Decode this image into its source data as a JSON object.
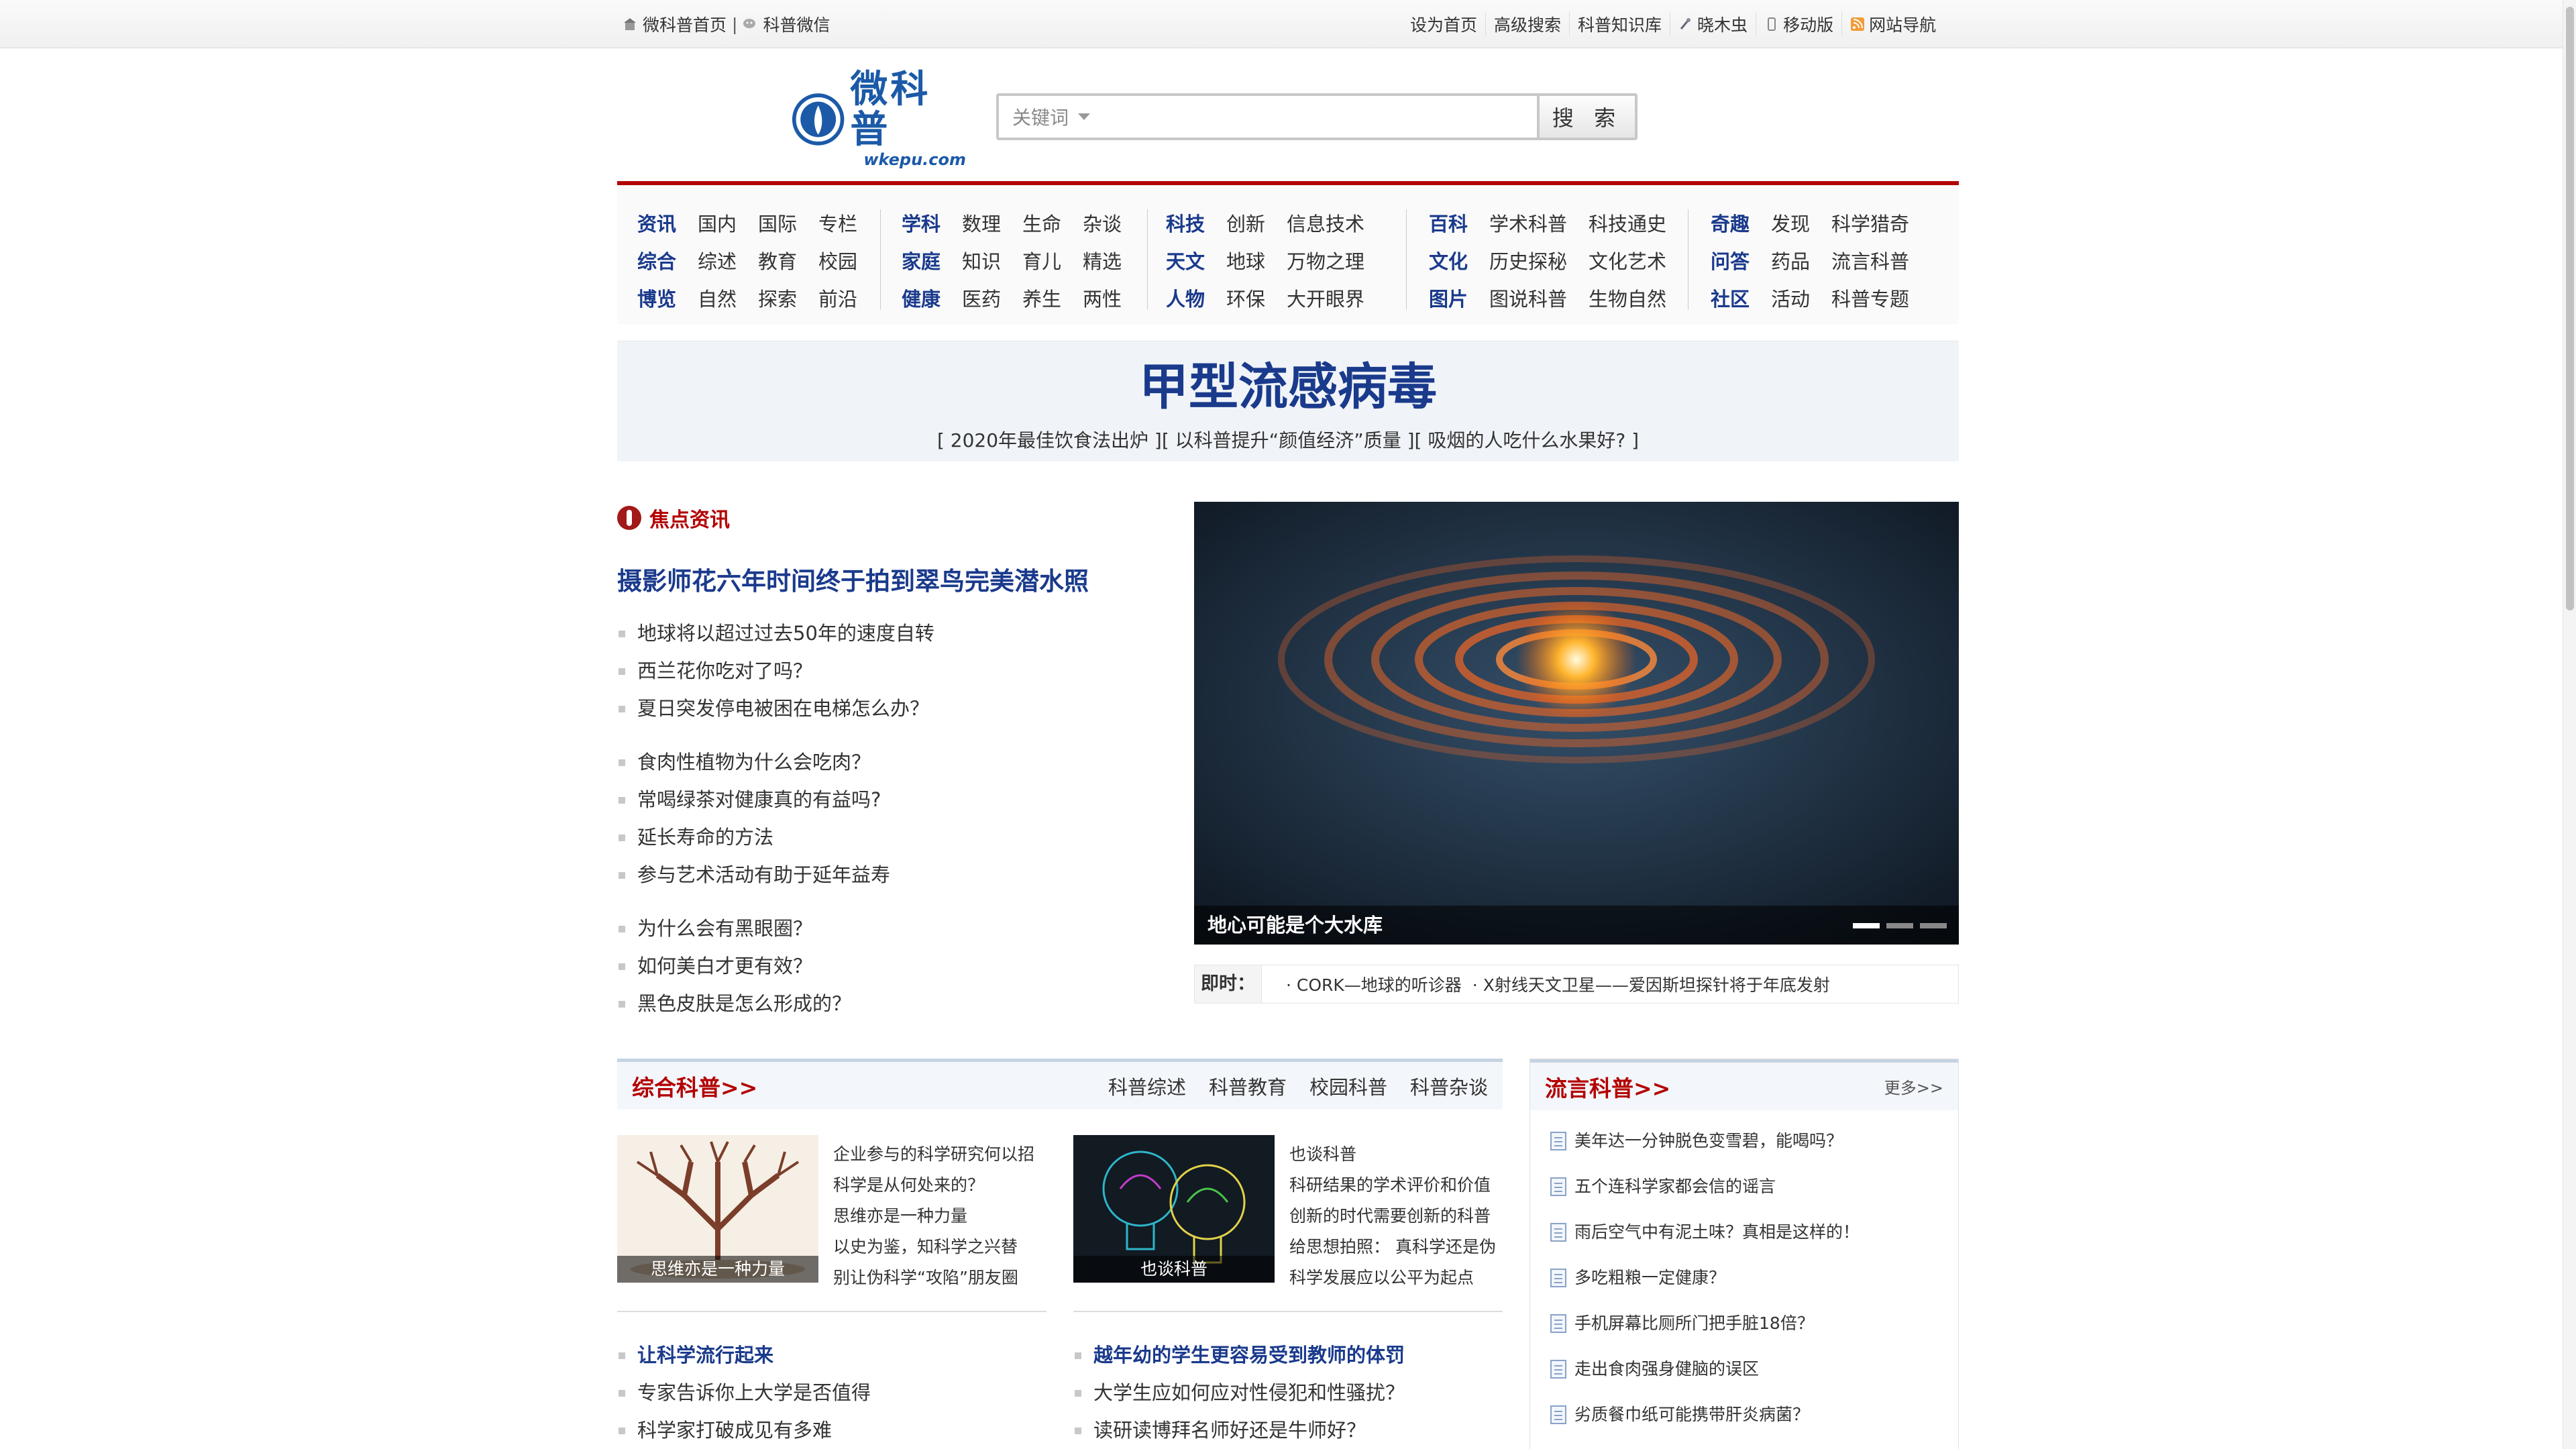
{
  "topbar": {
    "left": [
      "微科普首页",
      "科普微信"
    ],
    "right": [
      "设为首页",
      "高级搜索",
      "科普知识库",
      "晓木虫",
      "移动版",
      "网站导航"
    ]
  },
  "logo": {
    "cn": "微科普",
    "en": "wkepu.com"
  },
  "search": {
    "keyword_label": "关键词",
    "placeholder": "",
    "button": "搜 索"
  },
  "nav": {
    "groups": [
      {
        "rows": [
          {
            "head": "资讯",
            "items": [
              "国内",
              "国际",
              "专栏"
            ]
          },
          {
            "head": "综合",
            "items": [
              "综述",
              "教育",
              "校园"
            ]
          },
          {
            "head": "博览",
            "items": [
              "自然",
              "探索",
              "前沿"
            ]
          }
        ]
      },
      {
        "rows": [
          {
            "head": "学科",
            "items": [
              "数理",
              "生命",
              "杂谈"
            ]
          },
          {
            "head": "家庭",
            "items": [
              "知识",
              "育儿",
              "精选"
            ]
          },
          {
            "head": "健康",
            "items": [
              "医药",
              "养生",
              "两性"
            ]
          }
        ]
      },
      {
        "rows": [
          {
            "head": "科技",
            "items": [
              "创新",
              "信息技术"
            ]
          },
          {
            "head": "天文",
            "items": [
              "地球",
              "万物之理"
            ]
          },
          {
            "head": "人物",
            "items": [
              "环保",
              "大开眼界"
            ]
          }
        ]
      },
      {
        "rows": [
          {
            "head": "百科",
            "items": [
              "学术科普",
              "科技通史"
            ]
          },
          {
            "head": "文化",
            "items": [
              "历史探秘",
              "文化艺术"
            ]
          },
          {
            "head": "图片",
            "items": [
              "图说科普",
              "生物自然"
            ]
          }
        ]
      },
      {
        "rows": [
          {
            "head": "奇趣",
            "items": [
              "发现",
              "科学猎奇"
            ]
          },
          {
            "head": "问答",
            "items": [
              "药品",
              "流言科普"
            ]
          },
          {
            "head": "社区",
            "items": [
              "活动",
              "科普专题"
            ]
          }
        ]
      }
    ]
  },
  "headline": {
    "title": "甲型流感病毒",
    "subs": "[ 2020年最佳饮食法出炉 ][ 以科普提升“颜值经济”质量 ][ 吸烟的人吃什么水果好? ]"
  },
  "focus": {
    "title": "焦点资讯",
    "lead": "摄影师花六年时间终于拍到翠鸟完美潜水照",
    "groups": [
      [
        "地球将以超过过去50年的速度自转",
        "西兰花你吃对了吗？",
        "夏日突发停电被困在电梯怎么办？"
      ],
      [
        "食肉性植物为什么会吃肉？",
        "常喝绿茶对健康真的有益吗?",
        "延长寿命的方法",
        "参与艺术活动有助于延年益寿"
      ],
      [
        "为什么会有黑眼圈？",
        "如何美白才更有效？",
        "黑色皮肤是怎么形成的？"
      ]
    ]
  },
  "slider": {
    "caption": "地心可能是个大水库",
    "active_index": 0,
    "count": 3
  },
  "ticker": {
    "label": "即时：",
    "items": [
      "· CORK—地球的听诊器",
      "· X射线天文卫星——爱因斯坦探针将于年底发射"
    ]
  },
  "section": {
    "title": "综合科普>>",
    "tabs": [
      "科普综述",
      "科普教育",
      "校园科普",
      "科普杂谈"
    ],
    "col1": {
      "caption": "思维亦是一种力量",
      "links": [
        "企业参与的科学研究何以招",
        "科学是从何处来的？",
        "思维亦是一种力量",
        "以史为鉴，知科学之兴替",
        "别让伪科学“攻陷”朋友圈"
      ],
      "lead": "让科学流行起来",
      "list": [
        "专家告诉你上大学是否值得",
        "科学家打破成见有多难"
      ]
    },
    "col2": {
      "caption": "也谈科普",
      "links": [
        "也谈科普",
        "科研结果的学术评价和价值",
        "创新的时代需要创新的科普",
        "给思想拍照： 真科学还是伪",
        "科学发展应以公平为起点"
      ],
      "lead": "越年幼的学生更容易受到教师的体罚",
      "list": [
        "大学生应如何应对性侵犯和性骚扰？",
        "读研读博拜名师好还是牛师好？"
      ]
    }
  },
  "side": {
    "title": "流言科普>>",
    "more": "更多>>",
    "items": [
      "美年达一分钟脱色变雪碧，能喝吗？",
      "五个连科学家都会信的谣言",
      "雨后空气中有泥土味？真相是这样的！",
      "多吃粗粮一定健康？",
      "手机屏幕比厕所门把手脏18倍？",
      "走出食肉强身健脑的误区",
      "劣质餐巾纸可能携带肝炎病菌？"
    ]
  },
  "colors": {
    "brand_blue": "#1a3a8c",
    "accent_red": "#b30000"
  }
}
